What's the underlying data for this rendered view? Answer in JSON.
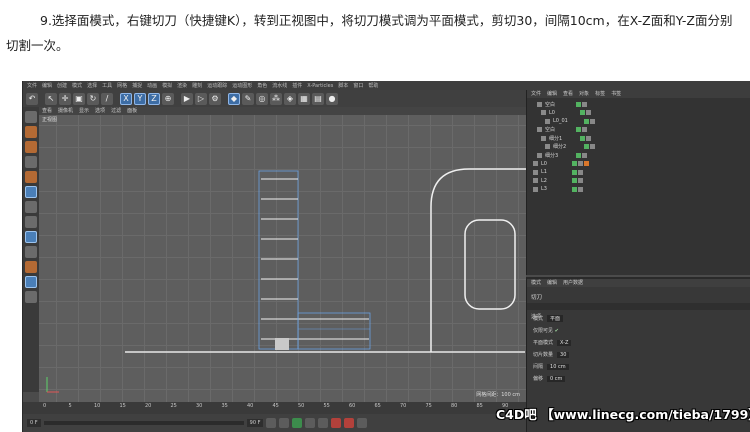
{
  "instruction": {
    "line1": "9.选择面模式，右键切刀（快捷键K），转到正视图中，将切刀模式调为平面模式，剪切30，间隔10cm，在X-Z面和Y-Z面分别",
    "line2": "切割一次。"
  },
  "app": {
    "menu": [
      "文件",
      "编辑",
      "创建",
      "模式",
      "选择",
      "工具",
      "网格",
      "捕捉",
      "动画",
      "模拟",
      "渲染",
      "雕刻",
      "运动跟踪",
      "运动图形",
      "角色",
      "流水线",
      "插件",
      "X-Particles",
      "脚本",
      "窗口",
      "帮助"
    ],
    "viewport": {
      "menu": [
        "查看",
        "摄像机",
        "显示",
        "选项",
        "过滤",
        "面板"
      ],
      "title": "正视图",
      "info": "网格间距：100 cm"
    },
    "timeline_ticks": [
      "0",
      "5",
      "10",
      "15",
      "20",
      "25",
      "30",
      "35",
      "40",
      "45",
      "50",
      "55",
      "60",
      "65",
      "70",
      "75",
      "80",
      "85",
      "90"
    ],
    "playbar": {
      "start": "0 F",
      "end": "90 F"
    },
    "object_manager": {
      "menu": [
        "文件",
        "编辑",
        "查看",
        "对象",
        "标签",
        "书签"
      ],
      "rows": [
        {
          "name": "空白"
        },
        {
          "name": "L0"
        },
        {
          "name": "L0_01"
        },
        {
          "name": "空白"
        },
        {
          "name": "细分1"
        },
        {
          "name": "细分2"
        },
        {
          "name": "细分3"
        },
        {
          "name": "L0"
        },
        {
          "name": "L1"
        },
        {
          "name": "L2"
        },
        {
          "name": "L3"
        }
      ]
    },
    "attribute_manager": {
      "tabs": [
        "模式",
        "编辑",
        "用户数据"
      ],
      "header": "切刀",
      "subtab": "选项",
      "mode_label": "模式",
      "mode_value": "平面",
      "visible_only": "仅限可见",
      "plane_mode_label": "平面模式",
      "plane_mode_value": "X-Z",
      "slices_label": "切片数量",
      "slices_value": "30",
      "spacing_label": "间隔",
      "spacing_value": "10 cm",
      "offset_label": "偏移",
      "offset_value": "0 cm"
    }
  },
  "watermark": "C4D吧 【www.linecg.com/tieba/1799】"
}
